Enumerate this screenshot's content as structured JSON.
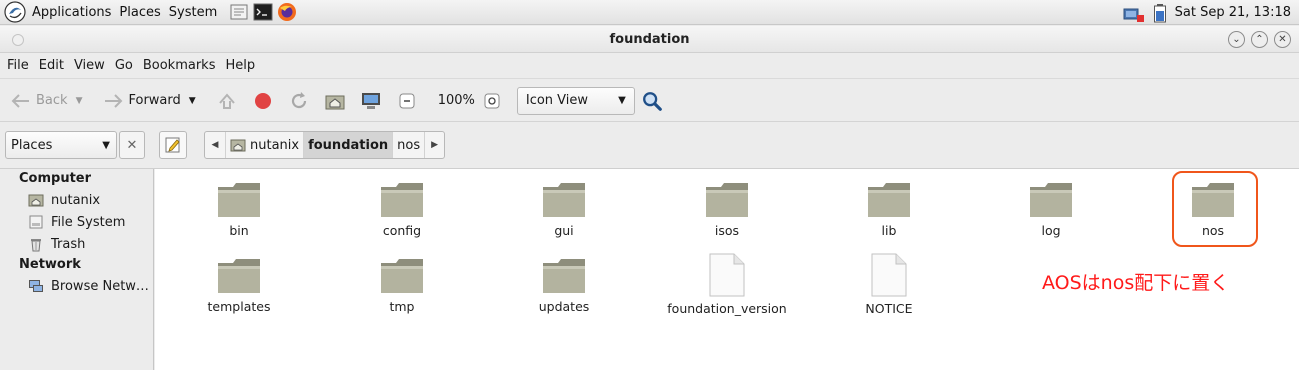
{
  "top_panel": {
    "menus": [
      "Applications",
      "Places",
      "System"
    ],
    "clock": "Sat Sep 21, 13:18"
  },
  "window": {
    "title": "foundation"
  },
  "menubar": [
    "File",
    "Edit",
    "View",
    "Go",
    "Bookmarks",
    "Help"
  ],
  "toolbar": {
    "back_label": "Back",
    "forward_label": "Forward",
    "zoom_level": "100%",
    "view_mode": "Icon View"
  },
  "location": {
    "places_label": "Places",
    "path_segments": [
      "nutanix",
      "foundation",
      "nos"
    ],
    "active_segment": "foundation"
  },
  "sidebar": {
    "sections": [
      {
        "title": "Computer",
        "items": [
          {
            "label": "nutanix",
            "icon": "home-folder-icon"
          },
          {
            "label": "File System",
            "icon": "drive-icon"
          },
          {
            "label": "Trash",
            "icon": "trash-icon"
          }
        ]
      },
      {
        "title": "Network",
        "items": [
          {
            "label": "Browse Netw…",
            "icon": "network-icon"
          }
        ]
      }
    ]
  },
  "files": [
    {
      "name": "bin",
      "type": "folder"
    },
    {
      "name": "config",
      "type": "folder"
    },
    {
      "name": "gui",
      "type": "folder"
    },
    {
      "name": "isos",
      "type": "folder"
    },
    {
      "name": "lib",
      "type": "folder"
    },
    {
      "name": "log",
      "type": "folder"
    },
    {
      "name": "nos",
      "type": "folder"
    },
    {
      "name": "templates",
      "type": "folder"
    },
    {
      "name": "tmp",
      "type": "folder"
    },
    {
      "name": "updates",
      "type": "folder"
    },
    {
      "name": "foundation_version",
      "type": "file"
    },
    {
      "name": "NOTICE",
      "type": "file"
    }
  ],
  "annotation": {
    "text": "AOSはnos配下に置く",
    "color": "#ff1a1a",
    "highlight_color": "#f0561b"
  }
}
